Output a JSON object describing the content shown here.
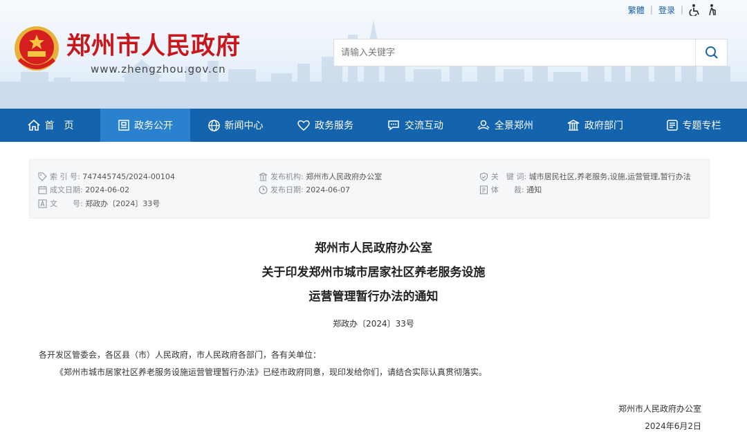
{
  "header": {
    "top_links": {
      "traditional": "繁體",
      "login": "登录"
    },
    "title": "郑州市人民政府",
    "url": "www.zhengzhou.gov.cn",
    "search_placeholder": "请输入关键字"
  },
  "nav": {
    "items": [
      {
        "label": "首　页",
        "icon": "home-icon"
      },
      {
        "label": "政务公开",
        "icon": "notice-board-icon",
        "active": true
      },
      {
        "label": "新闻中心",
        "icon": "globe-icon"
      },
      {
        "label": "政务服务",
        "icon": "heart-icon"
      },
      {
        "label": "交流互动",
        "icon": "chat-icon"
      },
      {
        "label": "全景郑州",
        "icon": "panorama-icon"
      },
      {
        "label": "政府部门",
        "icon": "building-icon"
      },
      {
        "label": "专题专栏",
        "icon": "column-icon"
      }
    ]
  },
  "meta": {
    "index_label": "索 引 号:",
    "index_value": "747445745/2024-00104",
    "issuer_label": "发布机构:",
    "issuer_value": "郑州市人民政府办公室",
    "keywords_label": "关　键 词:",
    "keywords_value": "城市居民社区,养老服务,设施,运营管理,暂行办法",
    "created_label": "成文日期:",
    "created_value": "2024-06-02",
    "published_label": "发布日期:",
    "published_value": "2024-06-07",
    "genre_label": "体　　裁:",
    "genre_value": "通知",
    "doc_label": "文　　号:",
    "doc_value": "郑政办〔2024〕33号"
  },
  "document": {
    "title_line1": "郑州市人民政府办公室",
    "title_line2": "关于印发郑州市城市居家社区养老服务设施",
    "title_line3": "运营管理暂行办法的通知",
    "doc_number": "郑政办〔2024〕33号",
    "salutation": "各开发区管委会，各区县（市）人民政府，市人民政府各部门，各有关单位：",
    "body": "《郑州市城市居家社区养老服务设施运营管理暂行办法》已经市政府同意，现印发给你们，请结合实际认真贯彻落实。",
    "signature": "郑州市人民政府办公室",
    "date": "2024年6月2日"
  },
  "colors": {
    "nav_bg": "#1363ad",
    "nav_active": "#2a82cf",
    "title_red": "#c8161d",
    "link_blue": "#1a5fa8"
  }
}
